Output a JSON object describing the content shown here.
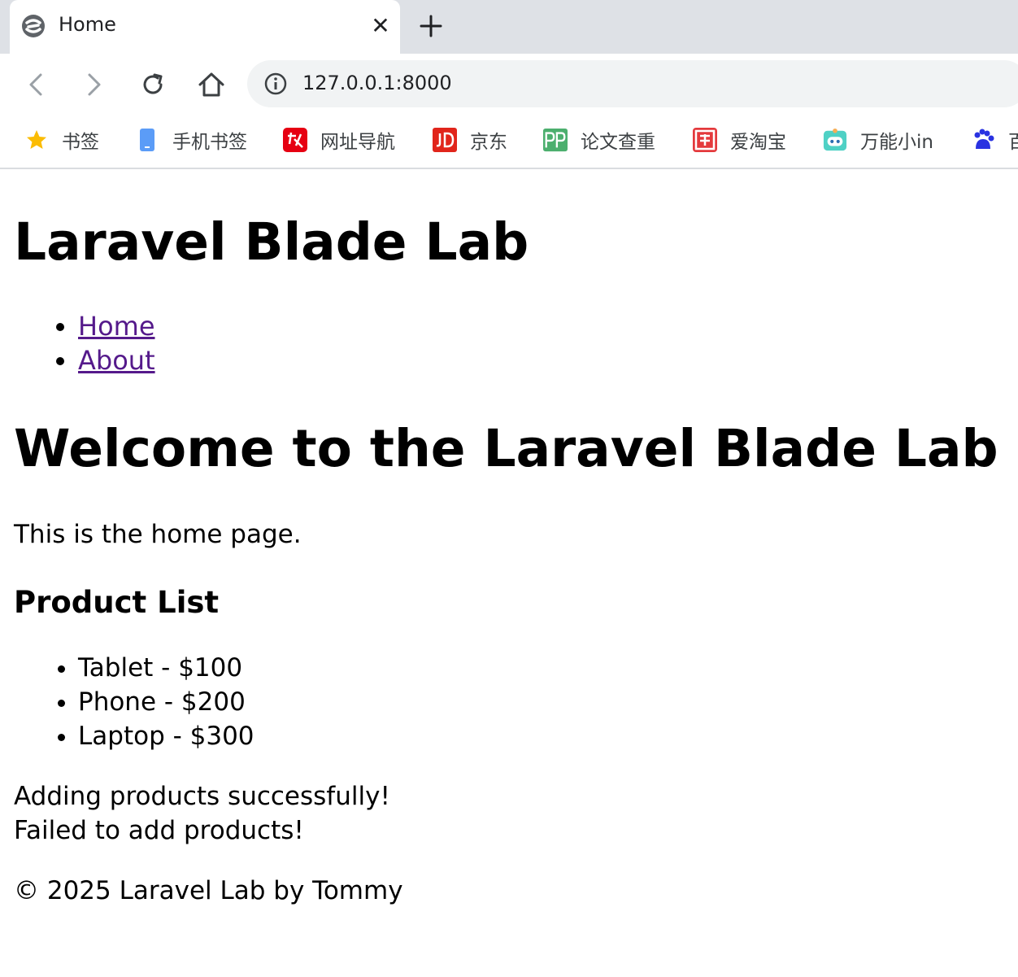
{
  "browser": {
    "tab_title": "Home",
    "close_glyph": "✕",
    "url": "127.0.0.1:8000",
    "bookmarks": [
      {
        "label": "书签",
        "icon": "star-icon"
      },
      {
        "label": "手机书签",
        "icon": "phone-icon"
      },
      {
        "label": "网址导航",
        "icon": "hao-icon"
      },
      {
        "label": "京东",
        "icon": "jd-icon"
      },
      {
        "label": "论文查重",
        "icon": "pp-icon"
      },
      {
        "label": "爱淘宝",
        "icon": "taobao-icon"
      },
      {
        "label": "万能小in",
        "icon": "robot-icon"
      },
      {
        "label": "百",
        "icon": "baidu-icon"
      }
    ]
  },
  "page": {
    "site_title": "Laravel Blade Lab",
    "nav": [
      {
        "label": "Home"
      },
      {
        "label": "About"
      }
    ],
    "welcome_heading": "Welcome to the Laravel Blade Lab",
    "intro": "This is the home page.",
    "products_heading": "Product List",
    "products": [
      "Tablet - $100",
      "Phone - $200",
      "Laptop - $300"
    ],
    "success_message": "Adding products successfully!",
    "failure_message": "Failed to add products!",
    "footer": "© 2025 Laravel Lab by Tommy"
  },
  "colors": {
    "tabstrip_bg": "#dee1e6",
    "omnibox_bg": "#f1f3f4",
    "visited_link": "#551a8b"
  }
}
